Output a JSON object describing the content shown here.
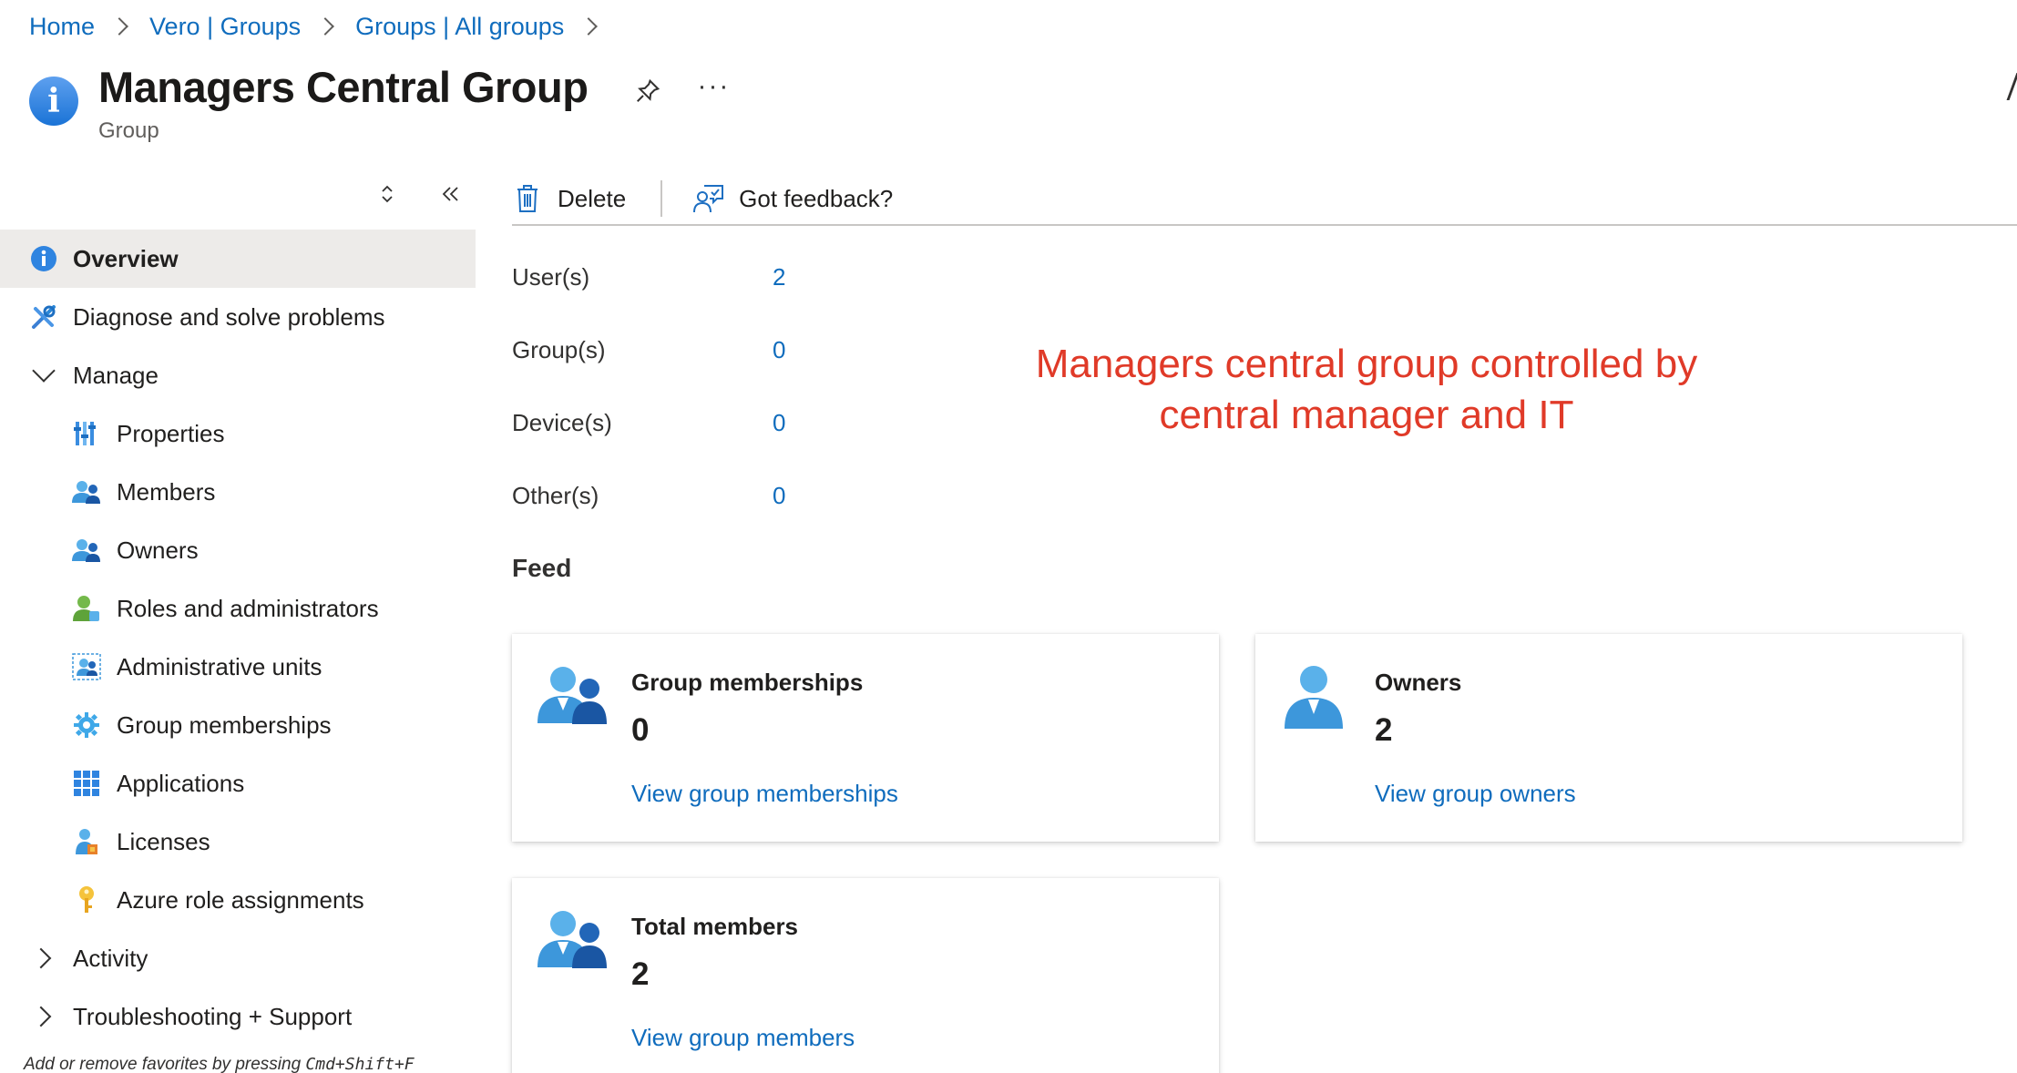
{
  "breadcrumb": [
    "Home",
    "Vero | Groups",
    "Groups | All groups"
  ],
  "header": {
    "title": "Managers Central Group",
    "subtitle": "Group"
  },
  "sidebar": {
    "items": [
      {
        "label": "Overview",
        "icon": "info-icon"
      },
      {
        "label": "Diagnose and solve problems",
        "icon": "wrench-icon"
      },
      {
        "label": "Manage",
        "icon": "chevron-down-icon"
      },
      {
        "label": "Properties",
        "icon": "properties-icon"
      },
      {
        "label": "Members",
        "icon": "users-icon"
      },
      {
        "label": "Owners",
        "icon": "users-icon"
      },
      {
        "label": "Roles and administrators",
        "icon": "user-role-icon"
      },
      {
        "label": "Administrative units",
        "icon": "admin-units-icon"
      },
      {
        "label": "Group memberships",
        "icon": "gear-icon"
      },
      {
        "label": "Applications",
        "icon": "grid-icon"
      },
      {
        "label": "Licenses",
        "icon": "license-icon"
      },
      {
        "label": "Azure role assignments",
        "icon": "key-icon"
      },
      {
        "label": "Activity",
        "icon": "chevron-right-icon"
      },
      {
        "label": "Troubleshooting + Support",
        "icon": "chevron-right-icon"
      }
    ],
    "hint_prefix": "Add or remove favorites by pressing ",
    "hint_keys": "Cmd+Shift+F"
  },
  "commands": {
    "delete": "Delete",
    "feedback": "Got feedback?"
  },
  "stats": [
    {
      "label": "User(s)",
      "value": "2"
    },
    {
      "label": "Group(s)",
      "value": "0"
    },
    {
      "label": "Device(s)",
      "value": "0"
    },
    {
      "label": "Other(s)",
      "value": "0"
    }
  ],
  "annotation": {
    "line1": "Managers central group controlled by",
    "line2": "central manager and IT",
    "color": "#e03a28"
  },
  "feed": {
    "title": "Feed",
    "cards": [
      {
        "title": "Group memberships",
        "value": "0",
        "link": "View group memberships"
      },
      {
        "title": "Owners",
        "value": "2",
        "link": "View group owners"
      },
      {
        "title": "Total members",
        "value": "2",
        "link": "View group members"
      }
    ]
  },
  "colors": {
    "link": "#0f6cbd",
    "active_bg": "#edebe9"
  }
}
